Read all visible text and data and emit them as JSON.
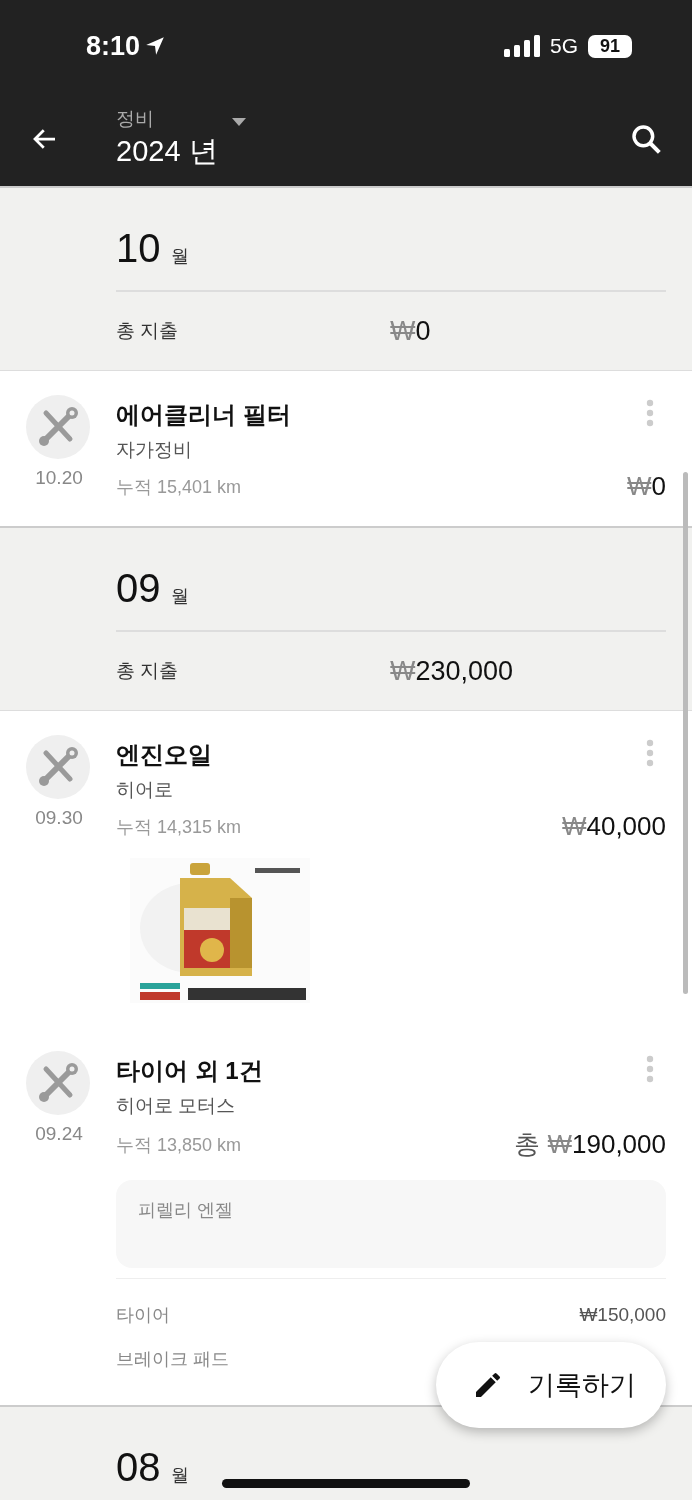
{
  "status_bar": {
    "time": "8:10",
    "network": "5G",
    "battery": "91"
  },
  "app_bar": {
    "subtitle": "정비",
    "title": "2024 년"
  },
  "months": [
    {
      "month": "10",
      "unit": "월",
      "total_label": "총 지출",
      "currency": "₩",
      "total": "0",
      "entries": [
        {
          "date": "10.20",
          "title": "에어클리너 필터",
          "subtitle": "자가정비",
          "odometer": "누적 15,401 km",
          "currency": "₩",
          "amount": "0"
        }
      ]
    },
    {
      "month": "09",
      "unit": "월",
      "total_label": "총 지출",
      "currency": "₩",
      "total": "230,000",
      "entries": [
        {
          "date": "09.30",
          "title": "엔진오일",
          "subtitle": "히어로",
          "odometer": "누적 14,315 km",
          "currency": "₩",
          "amount": "40,000"
        },
        {
          "date": "09.24",
          "title": "타이어 외 1건",
          "subtitle": "히어로 모터스",
          "odometer": "누적 13,850 km",
          "prefix": "총",
          "currency": "₩",
          "amount": "190,000",
          "memo": "피렐리 엔젤",
          "items": [
            {
              "name": "타이어",
              "price": "₩150,000"
            },
            {
              "name": "브레이크 패드"
            }
          ]
        }
      ]
    },
    {
      "month": "08",
      "unit": "월"
    }
  ],
  "fab": {
    "label": "기록하기"
  }
}
